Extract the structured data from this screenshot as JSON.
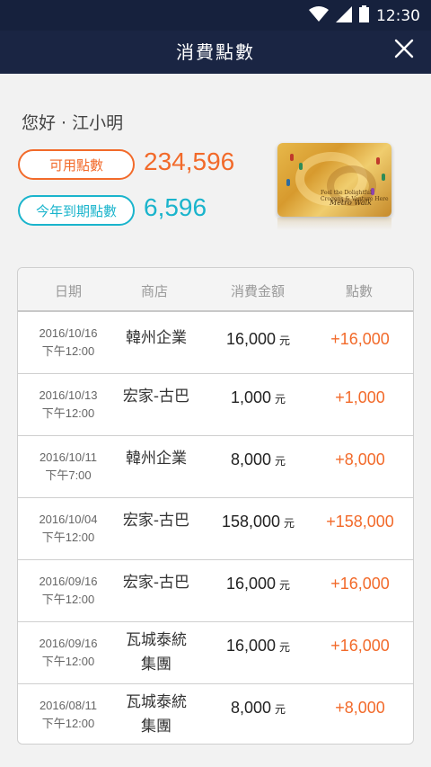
{
  "status_bar": {
    "time": "12:30"
  },
  "header": {
    "title": "消費點數"
  },
  "greeting": "您好 · 江小明",
  "points": {
    "available_label": "可用點數",
    "available_value": "234,596",
    "expiring_label": "今年到期點數",
    "expiring_value": "6,596"
  },
  "card": {
    "tagline": "Feel the Dolightful Crogens & Venture Here",
    "brand": "Metro Walk"
  },
  "colors": {
    "accent_orange": "#f26a2a",
    "accent_cyan": "#1ab4cc",
    "header_bg": "#1a2543"
  },
  "table": {
    "headers": [
      "日期",
      "商店",
      "消費金額",
      "點數"
    ],
    "currency": "元",
    "rows": [
      {
        "date": "2016/10/16",
        "time": "下午12:00",
        "store1": "韓州企業",
        "store2": "",
        "amount": "16,000",
        "points": "+16,000"
      },
      {
        "date": "2016/10/13",
        "time": "下午12:00",
        "store1": "宏家-古巴",
        "store2": "",
        "amount": "1,000",
        "points": "+1,000"
      },
      {
        "date": "2016/10/11",
        "time": "下午7:00",
        "store1": "韓州企業",
        "store2": "",
        "amount": "8,000",
        "points": "+8,000"
      },
      {
        "date": "2016/10/04",
        "time": "下午12:00",
        "store1": "宏家-古巴",
        "store2": "",
        "amount": "158,000",
        "points": "+158,000"
      },
      {
        "date": "2016/09/16",
        "time": "下午12:00",
        "store1": "宏家-古巴",
        "store2": "",
        "amount": "16,000",
        "points": "+16,000"
      },
      {
        "date": "2016/09/16",
        "time": "下午12:00",
        "store1": "瓦城泰統",
        "store2": "集團",
        "amount": "16,000",
        "points": "+16,000"
      },
      {
        "date": "2016/08/11",
        "time": "下午12:00",
        "store1": "瓦城泰統",
        "store2": "集團",
        "amount": "8,000",
        "points": "+8,000"
      }
    ]
  }
}
